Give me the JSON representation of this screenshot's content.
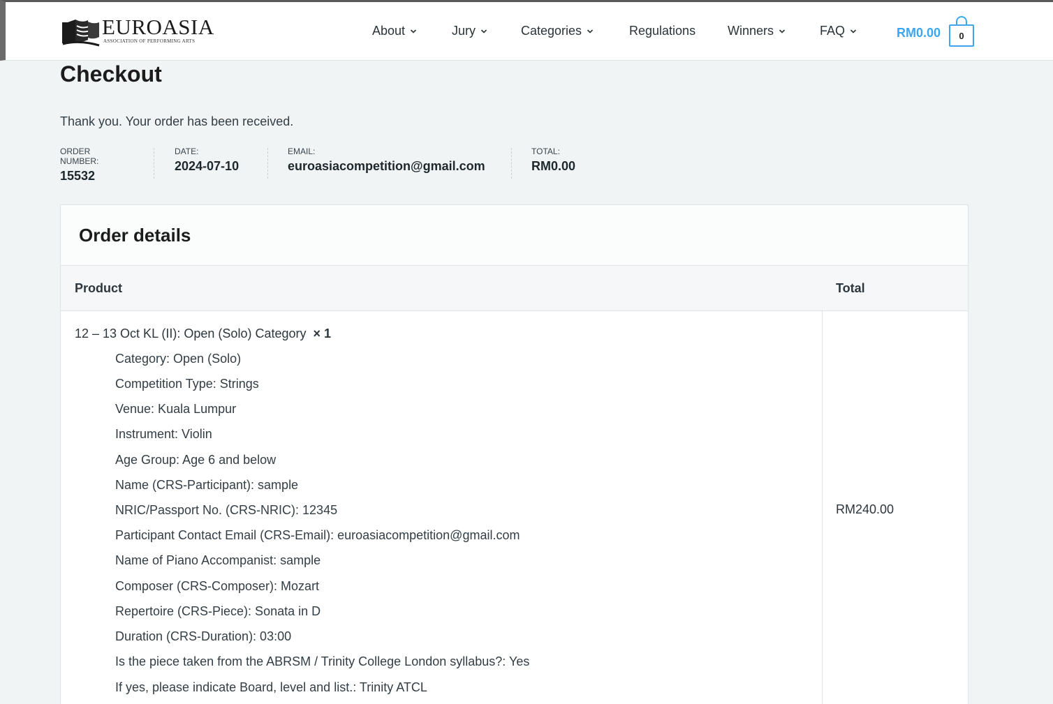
{
  "brand": {
    "name": "EUROASIA",
    "tagline": "ASSOCIATION OF PERFORMING ARTS"
  },
  "nav": [
    {
      "label": "About",
      "has_dropdown": true
    },
    {
      "label": "Jury",
      "has_dropdown": true
    },
    {
      "label": "Categories",
      "has_dropdown": true
    },
    {
      "label": "Regulations",
      "has_dropdown": false
    },
    {
      "label": "Winners",
      "has_dropdown": true
    },
    {
      "label": "FAQ",
      "has_dropdown": true
    }
  ],
  "cart": {
    "total": "RM0.00",
    "count": "0"
  },
  "page": {
    "title": "Checkout",
    "notice": "Thank you. Your order has been received."
  },
  "overview": [
    {
      "label": "ORDER NUMBER:",
      "value": "15532"
    },
    {
      "label": "DATE:",
      "value": "2024-07-10"
    },
    {
      "label": "EMAIL:",
      "value": "euroasiacompetition@gmail.com"
    },
    {
      "label": "TOTAL:",
      "value": "RM0.00"
    }
  ],
  "order_details": {
    "heading": "Order details",
    "columns": {
      "product": "Product",
      "total": "Total"
    },
    "item": {
      "name": "12 – 13 Oct KL (II): Open (Solo) Category",
      "quantity": "× 1",
      "total": "RM240.00",
      "meta": [
        "Category: Open (Solo)",
        "Competition Type: Strings",
        "Venue: Kuala Lumpur",
        "Instrument: Violin",
        "Age Group: Age 6 and below",
        "Name (CRS-Participant): sample",
        "NRIC/Passport No. (CRS-NRIC): 12345",
        "Participant Contact Email (CRS-Email): euroasiacompetition@gmail.com",
        "Name of Piano Accompanist: sample",
        "Composer (CRS-Composer): Mozart",
        "Repertoire (CRS-Piece): Sonata in D",
        "Duration (CRS-Duration): 03:00",
        "Is the piece taken from the ABRSM / Trinity College London syllabus?: Yes",
        "If yes, please indicate Board, level and list.: Trinity ATCL"
      ]
    }
  },
  "colors": {
    "accent": "#3aa7f0",
    "background": "#f0f4f5",
    "text": "#1f2a30"
  }
}
